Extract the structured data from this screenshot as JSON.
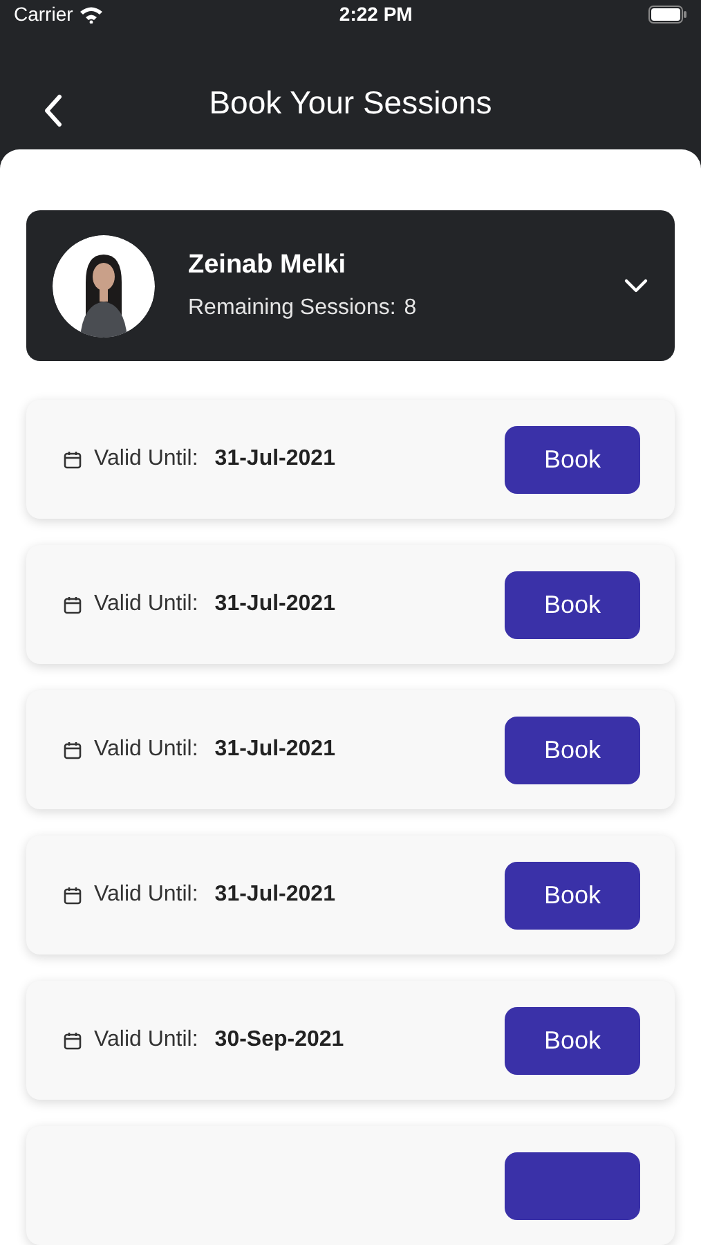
{
  "status_bar": {
    "carrier": "Carrier",
    "time": "2:22 PM"
  },
  "header": {
    "title": "Book Your Sessions"
  },
  "profile": {
    "name": "Zeinab Melki",
    "sessions_label": "Remaining Sessions:",
    "sessions_count": "8",
    "expanded": false
  },
  "sessions": [
    {
      "label": "Valid Until:",
      "date": "31-Jul-2021",
      "button": "Book"
    },
    {
      "label": "Valid Until:",
      "date": "31-Jul-2021",
      "button": "Book"
    },
    {
      "label": "Valid Until:",
      "date": "31-Jul-2021",
      "button": "Book"
    },
    {
      "label": "Valid Until:",
      "date": "31-Jul-2021",
      "button": "Book"
    },
    {
      "label": "Valid Until:",
      "date": "30-Sep-2021",
      "button": "Book"
    }
  ],
  "more_below": true
}
